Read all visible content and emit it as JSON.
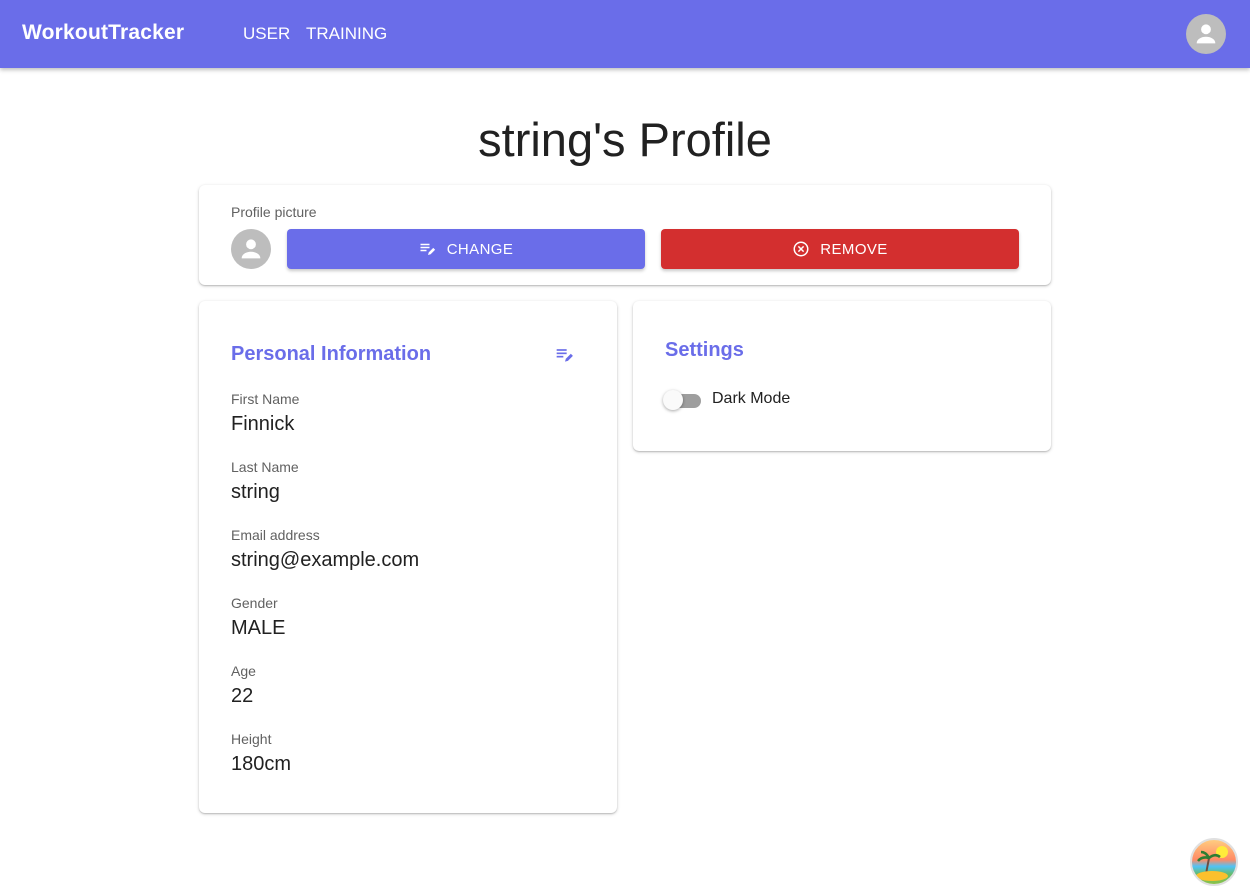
{
  "app": {
    "brand": "WorkoutTracker"
  },
  "nav": {
    "items": [
      {
        "label": "USER"
      },
      {
        "label": "TRAINING"
      }
    ]
  },
  "page": {
    "title": "string's Profile"
  },
  "profile_picture": {
    "label": "Profile picture",
    "change_label": "CHANGE",
    "remove_label": "REMOVE"
  },
  "personal_info": {
    "heading": "Personal Information",
    "fields": [
      {
        "label": "First Name",
        "value": "Finnick"
      },
      {
        "label": "Last Name",
        "value": "string"
      },
      {
        "label": "Email address",
        "value": "string@example.com"
      },
      {
        "label": "Gender",
        "value": "MALE"
      },
      {
        "label": "Age",
        "value": "22"
      },
      {
        "label": "Height",
        "value": "180cm"
      }
    ]
  },
  "settings": {
    "heading": "Settings",
    "dark_mode": {
      "label": "Dark Mode",
      "enabled": false
    }
  },
  "icons": {
    "account": "account-circle-icon",
    "edit": "playlist-edit-icon",
    "remove": "cancel-circle-icon",
    "badge": "beach-island-icon"
  },
  "colors": {
    "primary": "#6a6de9",
    "danger": "#d32f2f",
    "avatar_bg": "#bdbdbd"
  }
}
